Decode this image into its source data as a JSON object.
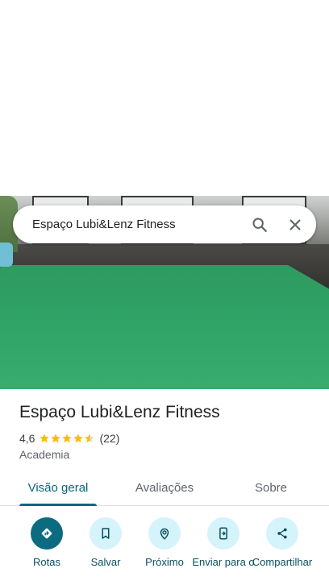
{
  "search": {
    "query": "Espaço Lubi&Lenz Fitness"
  },
  "place": {
    "name": "Espaço Lubi&Lenz Fitness",
    "rating": "4,6",
    "rating_value": 4.6,
    "review_count": "(22)",
    "category": "Academia"
  },
  "tabs": [
    {
      "label": "Visão geral",
      "active": true
    },
    {
      "label": "Avaliações",
      "active": false
    },
    {
      "label": "Sobre",
      "active": false
    }
  ],
  "actions": [
    {
      "label": "Rotas",
      "icon": "directions-icon"
    },
    {
      "label": "Salvar",
      "icon": "bookmark-icon"
    },
    {
      "label": "Próximo",
      "icon": "nearby-icon"
    },
    {
      "label": "Enviar para o",
      "icon": "send-to-phone-icon"
    },
    {
      "label": "Compartilhar",
      "icon": "share-icon"
    }
  ],
  "colors": {
    "accent": "#00697e",
    "action_bg": "#d5f3fa",
    "primary_action_bg": "#0b6b80",
    "star": "#fbbc04"
  }
}
